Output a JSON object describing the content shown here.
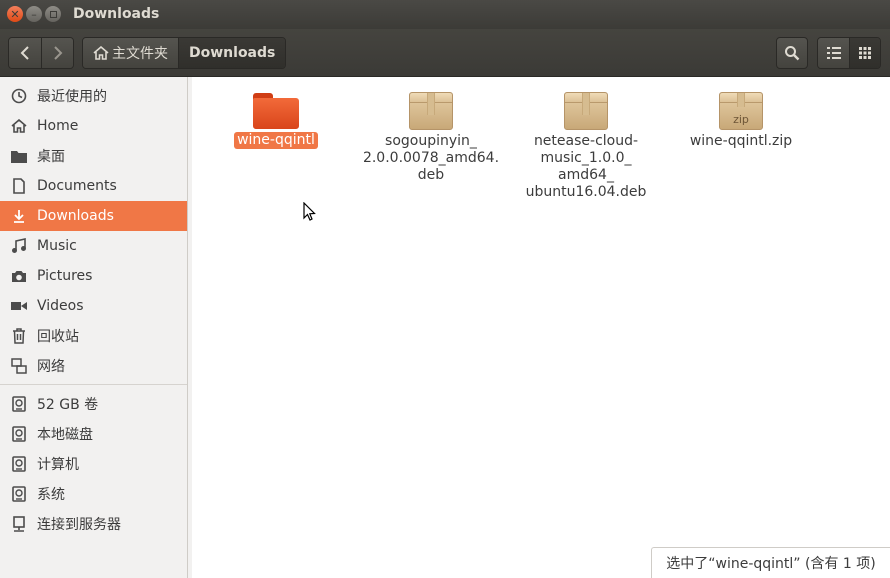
{
  "window": {
    "title": "Downloads"
  },
  "toolbar": {
    "path": [
      {
        "label": "主文件夹",
        "icon": "home-icon"
      },
      {
        "label": "Downloads"
      }
    ]
  },
  "sidebar": {
    "places": [
      {
        "label": "最近使用的",
        "icon": "clock-icon"
      },
      {
        "label": "Home",
        "icon": "home-icon"
      },
      {
        "label": "桌面",
        "icon": "desktop-folder-icon"
      },
      {
        "label": "Documents",
        "icon": "document-icon"
      },
      {
        "label": "Downloads",
        "icon": "download-icon",
        "selected": true
      },
      {
        "label": "Music",
        "icon": "music-icon"
      },
      {
        "label": "Pictures",
        "icon": "camera-icon"
      },
      {
        "label": "Videos",
        "icon": "video-icon"
      },
      {
        "label": "回收站",
        "icon": "trash-icon"
      },
      {
        "label": "网络",
        "icon": "network-icon"
      }
    ],
    "devices": [
      {
        "label": "52 GB 卷",
        "icon": "drive-icon"
      },
      {
        "label": "本地磁盘",
        "icon": "drive-icon"
      },
      {
        "label": "计算机",
        "icon": "drive-icon"
      },
      {
        "label": "系统",
        "icon": "drive-icon"
      },
      {
        "label": "连接到服务器",
        "icon": "server-icon"
      }
    ]
  },
  "files": [
    {
      "name": "wine-qqintl",
      "type": "folder",
      "selected": true
    },
    {
      "name_lines": [
        "sogoupinyin_",
        "2.0.0.0078_amd64.",
        "deb"
      ],
      "type": "package"
    },
    {
      "name_lines": [
        "netease-cloud-",
        "music_1.0.0_",
        "amd64_",
        "ubuntu16.04.deb"
      ],
      "type": "package"
    },
    {
      "name": "wine-qqintl.zip",
      "type": "zip",
      "badge": "zip"
    }
  ],
  "status": {
    "text": "选中了“wine-qqintl” (含有 1 项)"
  },
  "colors": {
    "accent": "#f07746",
    "titlebar": "#3c3b37"
  }
}
